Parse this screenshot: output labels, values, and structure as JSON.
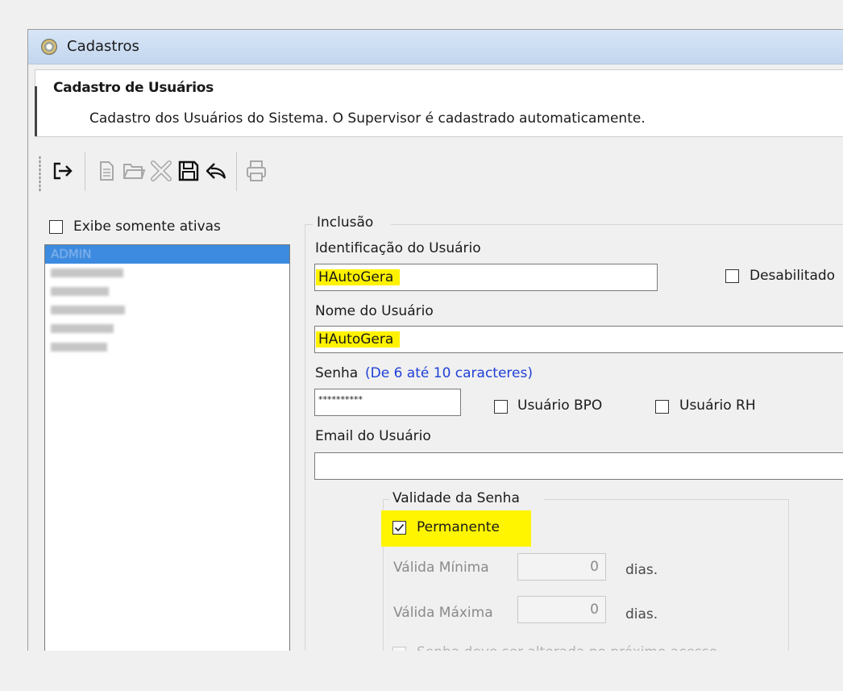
{
  "window": {
    "title": "Cadastros"
  },
  "header": {
    "title": "Cadastro de Usuários",
    "description": "Cadastro dos Usuários do Sistema. O Supervisor é cadastrado automaticamente."
  },
  "toolbar": {
    "buttons": [
      "exit-icon",
      "new-document-icon",
      "open-folder-icon",
      "delete-icon",
      "save-icon",
      "undo-icon",
      "print-icon"
    ]
  },
  "list": {
    "filter_label": "Exibe somente ativas",
    "items": [
      "ADMIN"
    ]
  },
  "form": {
    "group_label": "Inclusão",
    "user_id_label": "Identificação do Usuário",
    "user_id_value": "HAutoGera",
    "disabled_label": "Desabilitado",
    "user_name_label": "Nome do Usuário",
    "user_name_value": "HAutoGera",
    "password_label": "Senha",
    "password_hint": "(De 6 até 10 caracteres)",
    "password_value": "**********",
    "bpo_label": "Usuário BPO",
    "rh_label": "Usuário RH",
    "email_label": "Email do Usuário",
    "email_value": "",
    "validity": {
      "group_label": "Validade da Senha",
      "permanent_label": "Permanente",
      "permanent_checked": true,
      "min_label": "Válida Mínima",
      "min_value": "0",
      "max_label": "Válida Máxima",
      "max_value": "0",
      "days_label": "dias.",
      "change_next_label": "Senha deve ser alterada no próximo acesso"
    }
  },
  "colors": {
    "highlight": "#fff200",
    "selection": "#3c8be0",
    "hint": "#1f3fd7"
  }
}
